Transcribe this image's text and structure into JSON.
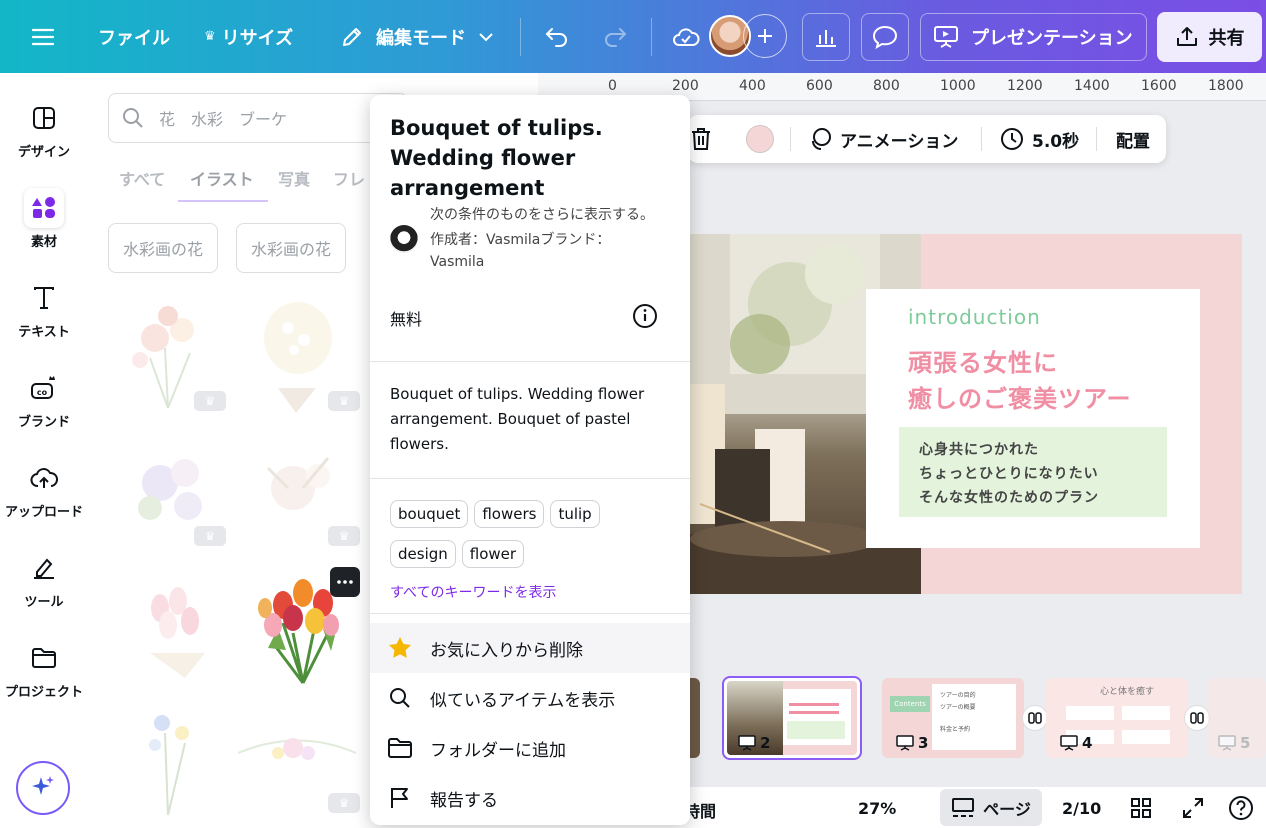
{
  "topbar": {
    "file_label": "ファイル",
    "resize_label": "リサイズ",
    "edit_mode_label": "編集モード",
    "present_label": "プレゼンテーション",
    "share_label": "共有"
  },
  "rail": {
    "items": [
      {
        "label": "デザイン",
        "icon": "layout-icon"
      },
      {
        "label": "素材",
        "icon": "elements-icon"
      },
      {
        "label": "テキスト",
        "icon": "text-icon"
      },
      {
        "label": "ブランド",
        "icon": "brand-icon"
      },
      {
        "label": "アップロード",
        "icon": "upload-icon"
      },
      {
        "label": "ツール",
        "icon": "tools-icon"
      },
      {
        "label": "プロジェクト",
        "icon": "folder-icon"
      }
    ]
  },
  "panel": {
    "search_placeholder": "花　水彩　ブーケ",
    "tabs": [
      "すべて",
      "イラスト",
      "写真",
      "フレ"
    ],
    "chips": [
      "水彩画の花",
      "水彩画の花"
    ]
  },
  "ruler": {
    "ticks": [
      "0",
      "200",
      "400",
      "600",
      "800",
      "1000",
      "1200",
      "1400",
      "1600",
      "1800"
    ]
  },
  "context_toolbar": {
    "animation_label": "アニメーション",
    "duration_label": "5.0秒",
    "position_label": "配置"
  },
  "slide": {
    "kicker": "introduction",
    "title_line1": "頑張る女性に",
    "title_line2": "癒しのご褒美ツアー",
    "body_line1": "心身共につかれた",
    "body_line2": "ちょっとひとりになりたい",
    "body_line3": "そんな女性のためのプラン"
  },
  "thumbnails": [
    {
      "num": "2",
      "selected": true
    },
    {
      "num": "3",
      "selected": false
    },
    {
      "num": "4",
      "selected": false
    },
    {
      "num": "5",
      "selected": false
    }
  ],
  "thumb3": {
    "label": "Contents",
    "lines": [
      "ツアーの目的",
      "ツアーの概要",
      "料金と予約"
    ]
  },
  "thumb4": {
    "title": "心と体を癒す"
  },
  "bottombar": {
    "timer_label": "時間",
    "zoom": "27%",
    "pages_label": "ページ",
    "page_count": "2/10"
  },
  "popup": {
    "title": "Bouquet of tulips. Wedding flower arrangement",
    "more_label": "次の条件のものをさらに表示する。",
    "author_label": "作成者：Vasmilaブランド：",
    "author_name": "Vasmila",
    "price_label": "無料",
    "description": "Bouquet of tulips. Wedding flower arrangement. Bouquet of pastel flowers.",
    "tags": [
      "bouquet",
      "flowers",
      "tulip",
      "design",
      "flower"
    ],
    "show_all_keywords": "すべてのキーワードを表示",
    "menu": {
      "remove_favorite": "お気に入りから削除",
      "show_similar": "似ているアイテムを表示",
      "add_folder": "フォルダーに追加",
      "report": "報告する"
    }
  },
  "colors": {
    "accent_purple": "#7d2ae8",
    "slide_pink": "#f4d6d6",
    "title_pink": "#f08fa4",
    "kicker_green": "#7ecb9a",
    "body_green_bg": "#e3f3dc"
  }
}
